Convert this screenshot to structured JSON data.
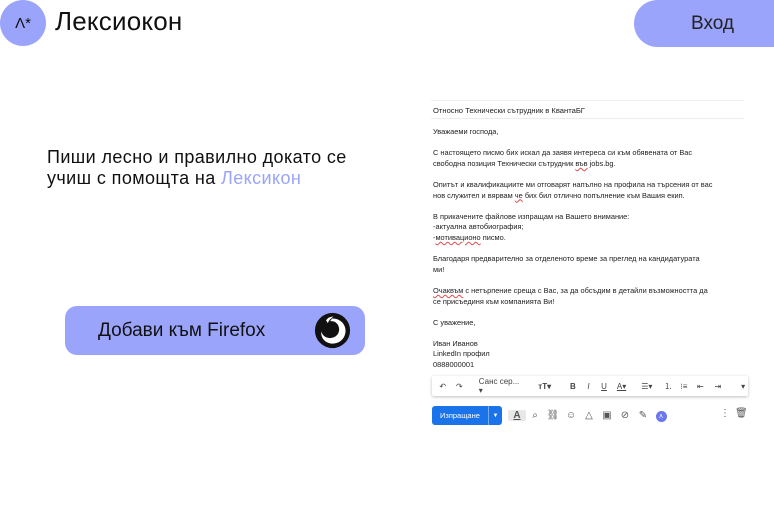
{
  "header": {
    "logo_mark": "Λ*",
    "brand": "Лексиокон",
    "login_label": "Вход"
  },
  "hero": {
    "line1": "Пиши лесно и правилно докато се",
    "line2_prefix": "учиш с помощта на ",
    "line2_accent": "Лексикон"
  },
  "cta": {
    "label": "Добави към Firefox"
  },
  "email": {
    "subject": "Относно Технически сътрудник в КвантаБГ",
    "greeting": "Уважаеми господа,",
    "p1a": "С настоящето писмо бих искал да заявя интереса си към обявената от Вас",
    "p1b_pre": "свободна позиция Технически сътрудник ",
    "p1b_err": "във",
    "p1b_post": " jobs.bg.",
    "p2a": "Опитът и квалификациите ми отговарят напълно на профила на търсения от вас",
    "p2b_pre": "нов служител и вярвам ",
    "p2b_err": "че",
    "p2b_post": " бих бил отлично попълнение към Вашия екип.",
    "p3a": "В прикачените файлове изпращам на Вашето внимание:",
    "p3b": "-актуална автобиография;",
    "p3c_pre": "-",
    "p3c_err": "мотивационо",
    "p3c_post": " писмо.",
    "p4a": "Благодаря предварително за отделеното време за преглед на кандидатурата",
    "p4b": "ми!",
    "p5a_err": "Очаквъм",
    "p5a_post": " с нетърпение среща с Вас, за да обсъдим в детайли възможността да",
    "p5b": "се присъединя към компанията Ви!",
    "closing": "С уважение,",
    "sig_name": "Иван Иванов",
    "sig_link": "LinkedIn профил",
    "sig_phone": "0888000001"
  },
  "toolbar": {
    "font_name": "Санс сер...",
    "send_label": "Изпращане"
  },
  "colors": {
    "accent": "#9ba4fb",
    "send_blue": "#1a73e8",
    "spell_error": "#e04b4b"
  }
}
